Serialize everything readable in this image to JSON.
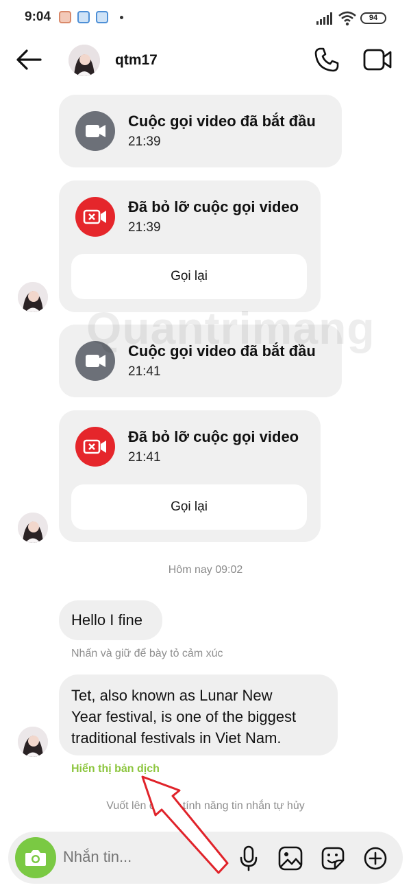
{
  "status_bar": {
    "time": "9:04",
    "battery": "94"
  },
  "header": {
    "username": "qtm17"
  },
  "messages": {
    "call1": {
      "title": "Cuộc gọi video đã bắt đầu",
      "time": "21:39"
    },
    "call2": {
      "title": "Đã bỏ lỡ cuộc gọi video",
      "time": "21:39",
      "button": "Gọi lại"
    },
    "call3": {
      "title": "Cuộc gọi video đã bắt đầu",
      "time": "21:41"
    },
    "call4": {
      "title": "Đã bỏ lỡ cuộc gọi video",
      "time": "21:41",
      "button": "Gọi lại"
    },
    "day_separator": "Hôm nay 09:02",
    "msg1": {
      "text": "Hello I fine",
      "hint": "Nhấn và giữ để bày tỏ cảm xúc"
    },
    "msg2": {
      "line1": "Tet, also known as Lunar New",
      "line2": "Year festival, is one of the biggest",
      "line3": "traditional festivals in Viet Nam."
    },
    "translate_link": "Hiển thị bản dịch",
    "swipe_hint": "Vuốt lên để bật tính năng tin nhắn tự hủy"
  },
  "watermark": "Quantrimang",
  "composer": {
    "placeholder": "Nhắn tin..."
  },
  "colors": {
    "missed_red": "#e5262b",
    "call_gray": "#6c7078",
    "camera_green": "#7ac943",
    "translate_green": "#8dc63f",
    "arrow_red": "#e0232a"
  },
  "icons": [
    "back-arrow-icon",
    "phone-icon",
    "video-icon",
    "camera-icon",
    "microphone-icon",
    "gallery-icon",
    "sticker-icon",
    "plus-icon"
  ]
}
